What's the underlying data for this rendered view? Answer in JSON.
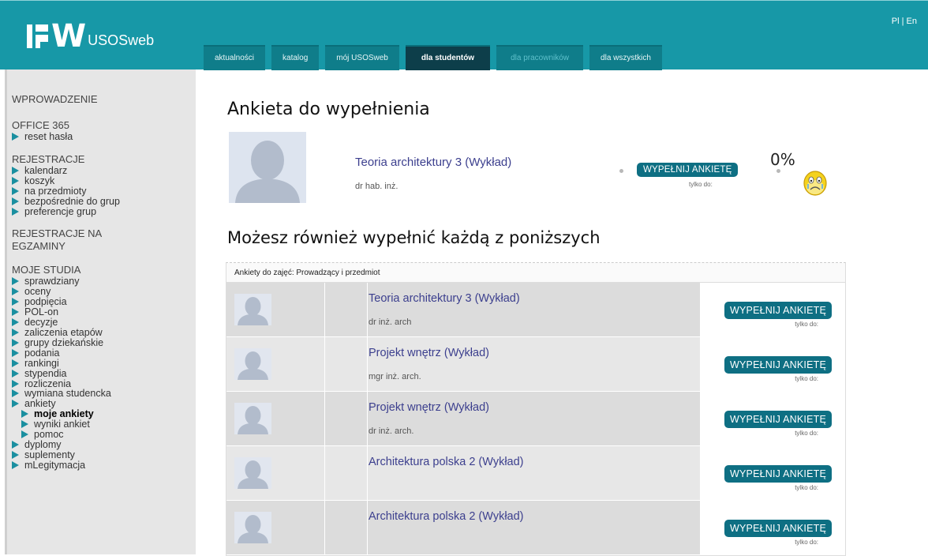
{
  "header": {
    "logo_text": "USOSweb",
    "logo_mark": "PW",
    "lang_pl": "Pl",
    "lang_sep": "|",
    "lang_en": "En",
    "tabs": [
      {
        "label": "aktualności"
      },
      {
        "label": "katalog"
      },
      {
        "label": "mój USOSweb"
      },
      {
        "label": "dla studentów"
      },
      {
        "label": "dla pracowników"
      },
      {
        "label": "dla wszystkich"
      }
    ],
    "active_tab": "dla studentów"
  },
  "sidebar": {
    "wprowadzenie": "WPROWADZENIE",
    "office": {
      "title": "OFFICE 365",
      "items": [
        "reset hasła"
      ]
    },
    "rejestracje": {
      "title": "REJESTRACJE",
      "items": [
        "kalendarz",
        "koszyk",
        "na przedmioty",
        "bezpośrednie do grup",
        "preferencje grup"
      ]
    },
    "rej_egz": {
      "title_line1": "REJESTRACJE NA",
      "title_line2": "EGZAMINY"
    },
    "moje_studia": {
      "title": "MOJE STUDIA",
      "items": [
        "sprawdziany",
        "oceny",
        "podpięcia",
        "POL-on",
        "decyzje",
        "zaliczenia etapów",
        "grupy dziekańskie",
        "podania",
        "rankingi",
        "stypendia",
        "rozliczenia",
        "wymiana studencka",
        "ankiety"
      ],
      "ankiety_sub": [
        "moje ankiety",
        "wyniki ankiet",
        "pomoc"
      ],
      "after": [
        "dyplomy",
        "suplementy",
        "mLegitymacja"
      ]
    }
  },
  "main": {
    "heading1": "Ankieta do wypełnienia",
    "featured": {
      "title": "Teoria architektury 3 (Wykład)",
      "teacher": "dr hab. inż.",
      "button": "WYPEŁNIJ ANKIETĘ",
      "note": "tylko do:",
      "progress": "0%"
    },
    "heading2": "Możesz również wypełnić każdą z poniższych",
    "table": {
      "caption": "Ankiety do zajęć: Prowadzący i przedmiot",
      "rows": [
        {
          "title": "Teoria architektury 3 (Wykład)",
          "teacher": "dr inż. arch",
          "button": "WYPEŁNIJ ANKIETĘ",
          "note": "tylko do:"
        },
        {
          "title": "Projekt wnętrz (Wykład)",
          "teacher": "mgr inż. arch.",
          "button": "WYPEŁNIJ ANKIETĘ",
          "note": "tylko do:"
        },
        {
          "title": "Projekt wnętrz (Wykład)",
          "teacher": "dr inż. arch.",
          "button": "WYPEŁNIJ ANKIETĘ",
          "note": "tylko do:"
        },
        {
          "title": "Architektura polska 2 (Wykład)",
          "teacher": "",
          "button": "WYPEŁNIJ ANKIETĘ",
          "note": "tylko do:"
        },
        {
          "title": "Architektura polska 2 (Wykład)",
          "teacher": "",
          "button": "WYPEŁNIJ ANKIETĘ",
          "note": "tylko do:"
        }
      ]
    }
  },
  "colors": {
    "header_bg": "#1798a7",
    "tab_active": "#0d3e4a",
    "button": "#0e6f83",
    "link": "#3c3f8e"
  }
}
